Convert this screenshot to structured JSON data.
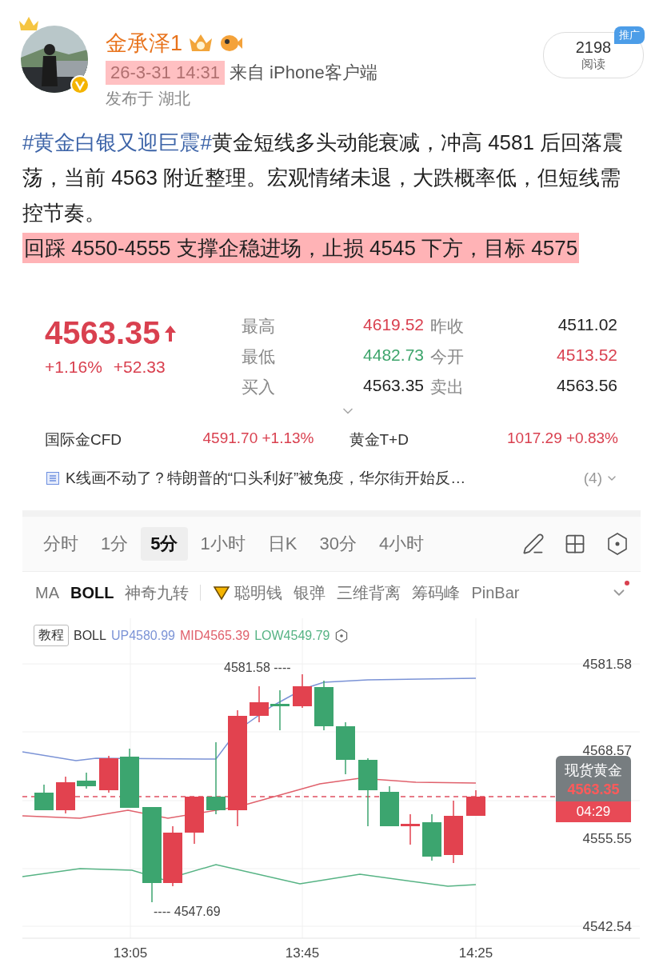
{
  "post": {
    "author": {
      "name": "金承泽1",
      "verified": true
    },
    "timestamp": {
      "text": "26-3-31 14:31",
      "highlighted": true
    },
    "source": "来自 iPhone客户端",
    "location": "发布于 湖北",
    "reads": {
      "count": "2198",
      "label": "阅读",
      "badge": "推广"
    }
  },
  "content": [
    {
      "highlighted": false,
      "segments": [
        {
          "kind": "hashtag",
          "text": "#黄金白银又迎巨震#"
        },
        {
          "kind": "plain",
          "text": "黄金短线多头动能衰减，冲高 4581 后回落震荡，当前 4563 附近整理。宏观情绪未退，大跌概率低，但短线需控节奏。"
        }
      ]
    },
    {
      "highlighted": true,
      "segments": [
        {
          "kind": "plain",
          "text": "回踩 4550-4555 支撑企稳进场，止损 4545 下方，目标 4575"
        }
      ]
    }
  ],
  "quote": {
    "price": "4563.35",
    "change_pct": "+1.16%",
    "change": "+52.33",
    "stats": [
      {
        "label": "最高",
        "value": "4619.52",
        "color": "#d9404f"
      },
      {
        "label": "昨收",
        "value": "4511.02",
        "color": "#222222"
      },
      {
        "label": "最低",
        "value": "4482.73",
        "color": "#3ea56c"
      },
      {
        "label": "今开",
        "value": "4513.52",
        "color": "#d9404f"
      },
      {
        "label": "买入",
        "value": "4563.35",
        "color": "#222222"
      },
      {
        "label": "卖出",
        "value": "4563.56",
        "color": "#222222"
      }
    ],
    "related": [
      {
        "name": "国际金CFD",
        "price": "4591.70",
        "change": "+1.13%"
      },
      {
        "name": "黄金T+D",
        "price": "1017.29",
        "change": "+0.83%"
      }
    ],
    "news": {
      "title": "K线画不动了？特朗普的“口头利好”被免疫，华尔街开始反…",
      "count": "(4)"
    }
  },
  "chart": {
    "periods": [
      {
        "label": "分时",
        "selected": false
      },
      {
        "label": "1分",
        "selected": false
      },
      {
        "label": "5分",
        "selected": true
      },
      {
        "label": "1小时",
        "selected": false
      },
      {
        "label": "日K",
        "selected": false
      },
      {
        "label": "30分",
        "selected": false
      },
      {
        "label": "4小时",
        "selected": false
      }
    ],
    "indicators": [
      {
        "label": "MA",
        "selected": false,
        "kind": "plain"
      },
      {
        "label": "BOLL",
        "selected": true,
        "kind": "plain"
      },
      {
        "label": "神奇九转",
        "selected": false,
        "kind": "plain"
      },
      {
        "label": "聪明钱",
        "selected": false,
        "kind": "featured"
      },
      {
        "label": "银弹",
        "selected": false,
        "kind": "plain"
      },
      {
        "label": "三维背离",
        "selected": false,
        "kind": "plain"
      },
      {
        "label": "筹码峰",
        "selected": false,
        "kind": "plain"
      },
      {
        "label": "PinBar",
        "selected": false,
        "kind": "plain"
      }
    ],
    "indicator_alert": true,
    "tutorial": "教程",
    "legend": {
      "name": "BOLL",
      "items": [
        {
          "text": "UP4580.99",
          "color": "#7b93d6"
        },
        {
          "text": "MID4565.39",
          "color": "#e0616c"
        },
        {
          "text": "LOW4549.79",
          "color": "#56b384"
        }
      ]
    },
    "price_axis": [
      "4581.58",
      "4568.57",
      "4555.55",
      "4542.54"
    ],
    "time_axis": [
      "13:05",
      "13:45",
      "14:25"
    ],
    "high_marker": "4581.58 ----",
    "low_marker": "---- 4547.69",
    "tooltip": {
      "title": "现货黄金",
      "price": "4563.35",
      "countdown": "04:29"
    }
  }
}
